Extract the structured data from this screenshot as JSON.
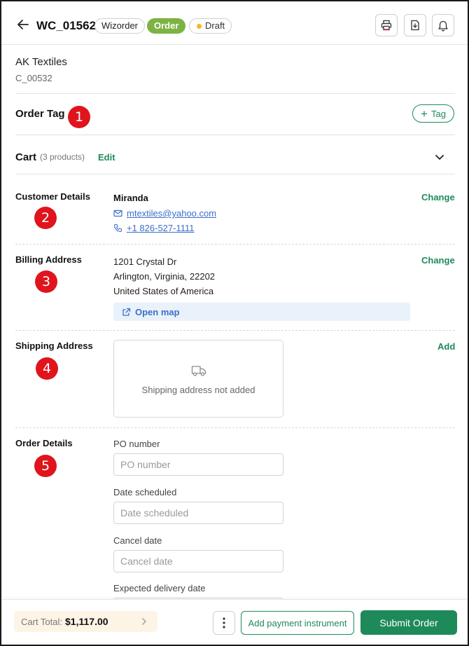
{
  "header": {
    "order_id": "WC_01562",
    "pills": {
      "source": "Wizorder",
      "type": "Order",
      "status": "Draft"
    },
    "icons": [
      "back-arrow-icon",
      "print-icon",
      "download-icon",
      "bell-icon"
    ]
  },
  "customer": {
    "name": "AK Textiles",
    "id": "C_00532"
  },
  "order_tag": {
    "title": "Order Tag",
    "add_label": "Tag",
    "badge": "1"
  },
  "cart": {
    "title": "Cart",
    "count_label": "(3 products)",
    "edit_label": "Edit"
  },
  "customer_details": {
    "title": "Customer Details",
    "badge": "2",
    "change_label": "Change",
    "contact_name": "Miranda",
    "email": "mtextiles@yahoo.com",
    "phone": "+1 826-527-1111"
  },
  "billing": {
    "title": "Billing Address",
    "badge": "3",
    "change_label": "Change",
    "line1": "1201 Crystal Dr",
    "line2": "Arlington, Virginia, 22202",
    "line3": "United States of America",
    "open_map_label": "Open map"
  },
  "shipping": {
    "title": "Shipping Address",
    "badge": "4",
    "add_label": "Add",
    "empty_text": "Shipping address not added"
  },
  "order_details": {
    "title": "Order Details",
    "badge": "5",
    "fields": [
      {
        "label": "PO number",
        "placeholder": "PO number"
      },
      {
        "label": "Date scheduled",
        "placeholder": "Date scheduled"
      },
      {
        "label": "Cancel date",
        "placeholder": "Cancel date"
      },
      {
        "label": "Expected delivery date",
        "placeholder": ""
      }
    ]
  },
  "footer": {
    "cart_total_label": "Cart Total:",
    "cart_total_value": "$1,117.00",
    "payment_label": "Add payment instrument",
    "submit_label": "Submit Order"
  },
  "colors": {
    "accent_green": "#1e8a5a",
    "order_pill": "#7cb342",
    "draft_dot": "#f2b824",
    "badge_red": "#e0141c",
    "link_blue": "#3c6fc9",
    "map_bg": "#e9f1fb",
    "total_bg": "#fdf4e6"
  }
}
